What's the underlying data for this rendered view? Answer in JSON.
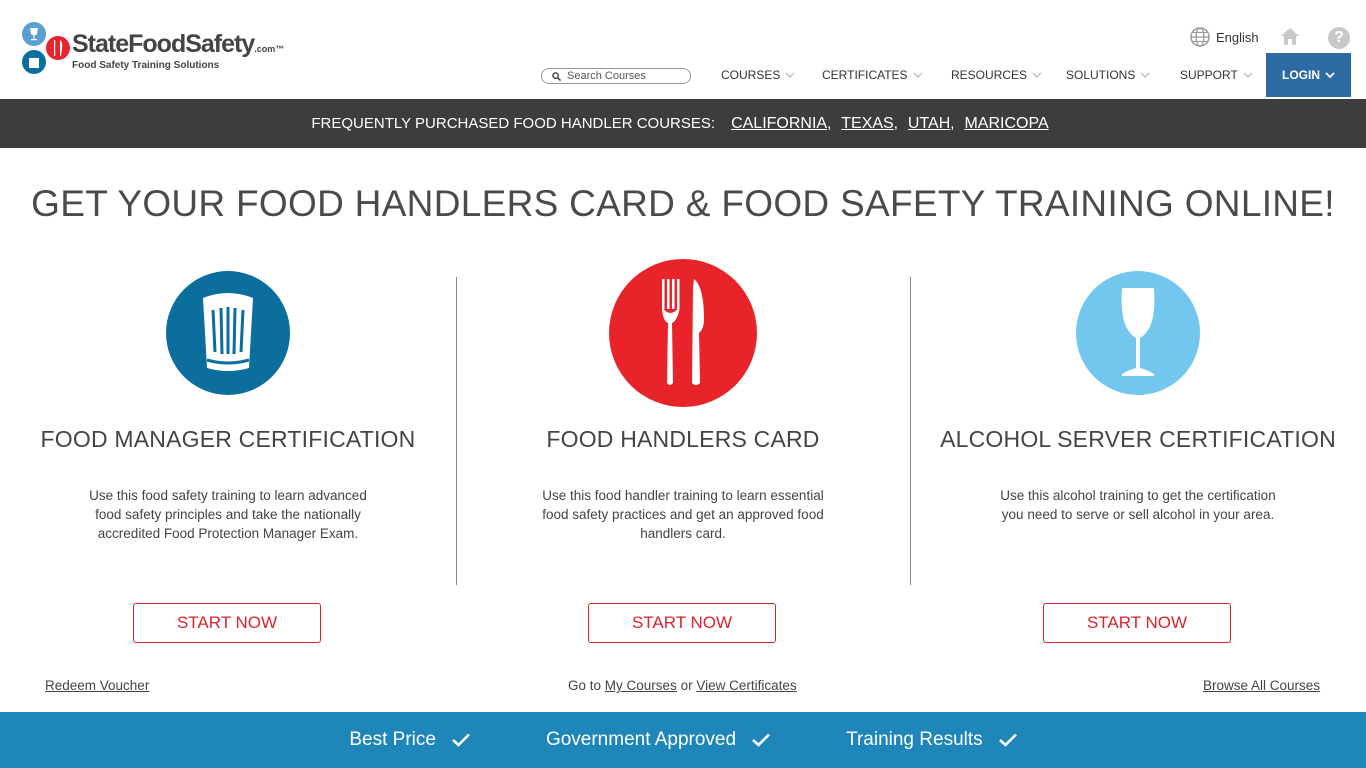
{
  "header": {
    "logo_text": "StateFoodSafety",
    "logo_com": ".com™",
    "logo_tagline": "Food Safety Training Solutions",
    "language": "English",
    "search_placeholder": "Search Courses",
    "nav": [
      {
        "label": "COURSES"
      },
      {
        "label": "CERTIFICATES"
      },
      {
        "label": "RESOURCES"
      },
      {
        "label": "SOLUTIONS"
      },
      {
        "label": "SUPPORT"
      }
    ],
    "login_label": "LOGIN"
  },
  "banner": {
    "label": "FREQUENTLY PURCHASED FOOD HANDLER COURSES:",
    "links": [
      "CALIFORNIA",
      "TEXAS",
      "UTAH",
      "MARICOPA"
    ]
  },
  "main": {
    "headline": "GET YOUR FOOD HANDLERS CARD & FOOD SAFETY TRAINING ONLINE!",
    "columns": [
      {
        "title": "FOOD MANAGER CERTIFICATION",
        "description": "Use this food safety training to learn advanced food safety principles and take the nationally accredited Food Protection Manager Exam.",
        "button": "START NOW",
        "icon": "chef-hat-icon",
        "color": "#0b6e9d"
      },
      {
        "title": "FOOD HANDLERS CARD",
        "description": "Use this food handler training to learn essential food safety practices and get an approved food handlers card.",
        "button": "START NOW",
        "icon": "fork-knife-icon",
        "color": "#e8232a"
      },
      {
        "title": "ALCOHOL SERVER CERTIFICATION",
        "description": "Use this alcohol training to get the certification you need to serve or sell alcohol in your area.",
        "button": "START NOW",
        "icon": "wine-glass-icon",
        "color": "#73c7ee"
      }
    ]
  },
  "links": {
    "redeem_voucher": "Redeem Voucher",
    "go_to": "Go to",
    "my_courses": "My Courses",
    "or": "or",
    "view_certificates": "View Certificates",
    "browse_all": "Browse All Courses"
  },
  "footer": {
    "items": [
      "Best Price",
      "Government Approved",
      "Training Results"
    ]
  }
}
